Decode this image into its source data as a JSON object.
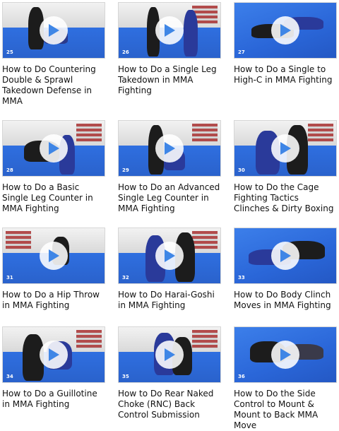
{
  "videos": [
    {
      "number": "25",
      "title": "How to Do Countering Double & Sprawl Takedown Defense in MMA"
    },
    {
      "number": "26",
      "title": "How to Do a Single Leg Takedown in MMA Fighting"
    },
    {
      "number": "27",
      "title": "How to Do a Single to High-C in MMA Fighting"
    },
    {
      "number": "28",
      "title": "How to Do a Basic Single Leg Counter in MMA Fighting"
    },
    {
      "number": "29",
      "title": "How to Do an Advanced Single Leg Counter in MMA Fighting"
    },
    {
      "number": "30",
      "title": "How to Do the Cage Fighting Tactics Clinches & Dirty Boxing"
    },
    {
      "number": "31",
      "title": "How to Do a Hip Throw in MMA Fighting"
    },
    {
      "number": "32",
      "title": "How to Do Harai-Goshi in MMA Fighting"
    },
    {
      "number": "33",
      "title": "How to Do Body Clinch Moves in MMA Fighting"
    },
    {
      "number": "34",
      "title": "How to Do a Guillotine in MMA Fighting"
    },
    {
      "number": "35",
      "title": "How to Do Rear Naked Choke (RNC) Back Control Submission"
    },
    {
      "number": "36",
      "title": "How to Do the Side Control to Mount & Mount to Back MMA Move"
    }
  ],
  "colors": {
    "mat_blue": "#2f6fe0",
    "play_button": "#ffffff",
    "play_triangle": "#3f86e6",
    "title_text": "#111111"
  },
  "icons": {
    "play": "play-icon"
  }
}
